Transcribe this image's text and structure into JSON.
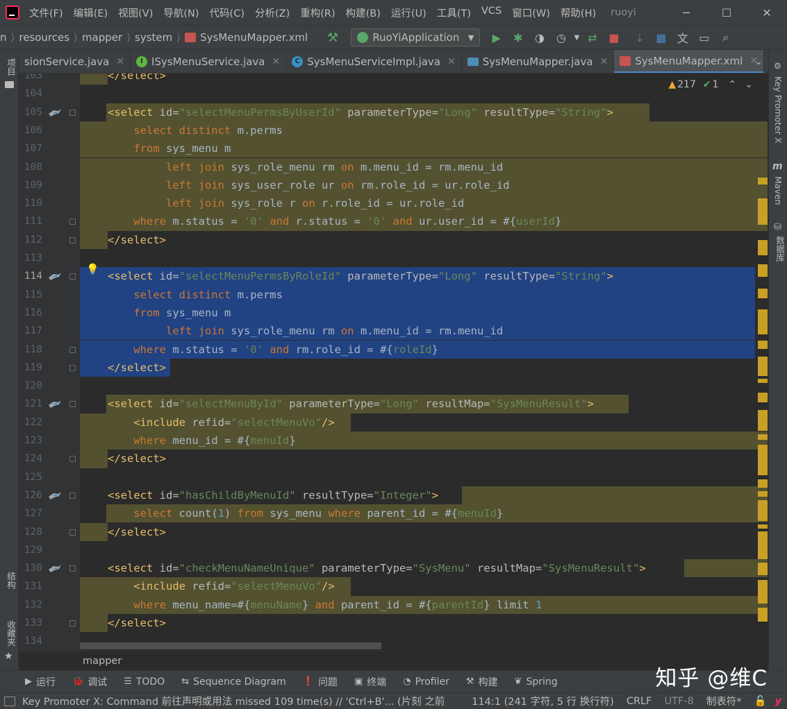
{
  "menubar": {
    "items": [
      "文件(F)",
      "编辑(E)",
      "视图(V)",
      "导航(N)",
      "代码(C)",
      "分析(Z)",
      "重构(R)",
      "构建(B)",
      "运行(U)",
      "工具(T)",
      "VCS",
      "窗口(W)",
      "帮助(H)"
    ],
    "project_name": "ruoyi"
  },
  "breadcrumb": {
    "items": [
      "n",
      "resources",
      "mapper",
      "system",
      "SysMenuMapper.xml"
    ]
  },
  "run_config": {
    "label": "RuoYiApplication"
  },
  "tabs": [
    {
      "label": "sionService.java",
      "icon": "none",
      "active": false
    },
    {
      "label": "ISysMenuService.java",
      "icon": "interface",
      "active": false
    },
    {
      "label": "SysMenuServiceImpl.java",
      "icon": "class",
      "active": false
    },
    {
      "label": "SysMenuMapper.java",
      "icon": "mapper",
      "active": false
    },
    {
      "label": "SysMenuMapper.xml",
      "icon": "xml",
      "active": true
    }
  ],
  "left_tools": {
    "project": "项目",
    "structure": "结构",
    "favorites": "收藏夹"
  },
  "right_tools": {
    "key_promoter": "Key Promoter X",
    "maven": "Maven",
    "database": "数据库"
  },
  "inspections": {
    "warnings": "217",
    "ok": "1"
  },
  "editor": {
    "lines": [
      {
        "n": "103",
        "hl": [
          [
            0,
            40
          ]
        ],
        "tokens": [
          [
            "t-tag",
            "</select>"
          ]
        ]
      },
      {
        "n": "104",
        "tokens": []
      },
      {
        "n": "105",
        "bird": true,
        "fold": true,
        "hl": [
          [
            38,
            820
          ]
        ],
        "tokens": [
          [
            "t-tag",
            "<select "
          ],
          [
            "t-attr",
            "id="
          ],
          [
            "t-val",
            "\"selectMenuPermsByUserId\""
          ],
          [
            "t-attr",
            " parameterType="
          ],
          [
            "t-val",
            "\"Long\""
          ],
          [
            "t-attr",
            " resultType="
          ],
          [
            "t-val",
            "\"String\""
          ],
          [
            "t-tag",
            ">"
          ]
        ]
      },
      {
        "n": "106",
        "hl": [
          [
            0,
            990
          ]
        ],
        "tokens": [
          [
            "t-plain",
            "    "
          ],
          [
            "t-kw",
            "select distinct "
          ],
          [
            "t-plain",
            "m.perms"
          ]
        ]
      },
      {
        "n": "107",
        "hl": [
          [
            0,
            990
          ]
        ],
        "tokens": [
          [
            "t-plain",
            "    "
          ],
          [
            "t-kw",
            "from "
          ],
          [
            "t-plain",
            "sys_menu m"
          ]
        ]
      },
      {
        "n": "108",
        "hl": [
          [
            0,
            990
          ]
        ],
        "tokens": [
          [
            "t-plain",
            "         "
          ],
          [
            "t-kw",
            "left join "
          ],
          [
            "t-plain",
            "sys_role_menu rm "
          ],
          [
            "t-kw",
            "on "
          ],
          [
            "t-plain",
            "m.menu_id = rm.menu_id"
          ]
        ]
      },
      {
        "n": "109",
        "hl": [
          [
            0,
            990
          ]
        ],
        "tokens": [
          [
            "t-plain",
            "         "
          ],
          [
            "t-kw",
            "left join "
          ],
          [
            "t-plain",
            "sys_user_role ur "
          ],
          [
            "t-kw",
            "on "
          ],
          [
            "t-plain",
            "rm.role_id = ur.role_id"
          ]
        ]
      },
      {
        "n": "110",
        "hl": [
          [
            0,
            990
          ]
        ],
        "tokens": [
          [
            "t-plain",
            "         "
          ],
          [
            "t-kw",
            "left join "
          ],
          [
            "t-plain",
            "sys_role r "
          ],
          [
            "t-kw",
            "on "
          ],
          [
            "t-plain",
            "r.role_id = ur.role_id"
          ]
        ]
      },
      {
        "n": "111",
        "fold": true,
        "hl": [
          [
            0,
            990
          ]
        ],
        "tokens": [
          [
            "t-plain",
            "    "
          ],
          [
            "t-kw",
            "where "
          ],
          [
            "t-plain",
            "m.status = "
          ],
          [
            "t-val",
            "'0' "
          ],
          [
            "t-kw",
            "and "
          ],
          [
            "t-plain",
            "r.status = "
          ],
          [
            "t-val",
            "'0' "
          ],
          [
            "t-kw",
            "and "
          ],
          [
            "t-plain",
            "ur.user_id = #{"
          ],
          [
            "t-val",
            "userId"
          ],
          [
            "t-plain",
            "}"
          ]
        ]
      },
      {
        "n": "112",
        "fold": true,
        "hl": [
          [
            0,
            40
          ]
        ],
        "tokens": [
          [
            "t-tag",
            "</select>"
          ]
        ]
      },
      {
        "n": "113",
        "tokens": []
      },
      {
        "n": "114",
        "cur": true,
        "bird": true,
        "bulb": true,
        "fold": true,
        "sel": [
          [
            0,
            972
          ]
        ],
        "tokens": [
          [
            "t-tag",
            "<select "
          ],
          [
            "t-attr",
            "id="
          ],
          [
            "t-val",
            "\"selectMenuPermsByRoleId\""
          ],
          [
            "t-attr",
            " parameterType="
          ],
          [
            "t-val",
            "\"Long\""
          ],
          [
            "t-attr",
            " resultType="
          ],
          [
            "t-val",
            "\"String\""
          ],
          [
            "t-tag",
            ">"
          ]
        ]
      },
      {
        "n": "115",
        "sel": [
          [
            0,
            972
          ]
        ],
        "tokens": [
          [
            "t-plain",
            "    "
          ],
          [
            "t-kw",
            "select distinct "
          ],
          [
            "t-plain",
            "m.perms"
          ]
        ]
      },
      {
        "n": "116",
        "sel": [
          [
            0,
            972
          ]
        ],
        "tokens": [
          [
            "t-plain",
            "    "
          ],
          [
            "t-kw",
            "from "
          ],
          [
            "t-plain",
            "sys_menu m"
          ]
        ]
      },
      {
        "n": "117",
        "sel": [
          [
            0,
            972
          ]
        ],
        "tokens": [
          [
            "t-plain",
            "         "
          ],
          [
            "t-kw",
            "left join "
          ],
          [
            "t-plain",
            "sys_role_menu rm "
          ],
          [
            "t-kw",
            "on "
          ],
          [
            "t-plain",
            "m.menu_id = rm.menu_id"
          ]
        ]
      },
      {
        "n": "118",
        "fold": true,
        "sel": [
          [
            0,
            972
          ]
        ],
        "tokens": [
          [
            "t-plain",
            "    "
          ],
          [
            "t-kw",
            "where "
          ],
          [
            "t-plain",
            "m.status = "
          ],
          [
            "t-val",
            "'0' "
          ],
          [
            "t-kw",
            "and "
          ],
          [
            "t-plain",
            "rm.role_id = #{"
          ],
          [
            "t-val",
            "roleId"
          ],
          [
            "t-plain",
            "}"
          ]
        ]
      },
      {
        "n": "119",
        "fold": true,
        "sel": [
          [
            0,
            130
          ]
        ],
        "tokens": [
          [
            "t-tag",
            "</select>"
          ]
        ]
      },
      {
        "n": "120",
        "tokens": []
      },
      {
        "n": "121",
        "bird": true,
        "fold": true,
        "hl": [
          [
            38,
            790
          ]
        ],
        "tokens": [
          [
            "t-tag",
            "<select "
          ],
          [
            "t-attr",
            "id="
          ],
          [
            "t-val",
            "\"selectMenuById\""
          ],
          [
            "t-attr",
            " parameterType="
          ],
          [
            "t-val",
            "\"Long\""
          ],
          [
            "t-attr",
            " resultMap="
          ],
          [
            "t-val",
            "\"SysMenuResult\""
          ],
          [
            "t-tag",
            ">"
          ]
        ]
      },
      {
        "n": "122",
        "hl": [
          [
            0,
            390
          ]
        ],
        "tokens": [
          [
            "t-plain",
            "    "
          ],
          [
            "t-tag",
            "<include "
          ],
          [
            "t-attr",
            "refid="
          ],
          [
            "t-val",
            "\"selectMenuVo\""
          ],
          [
            "t-tag",
            "/>"
          ]
        ]
      },
      {
        "n": "123",
        "hl": [
          [
            0,
            990
          ]
        ],
        "tokens": [
          [
            "t-plain",
            "    "
          ],
          [
            "t-kw",
            "where "
          ],
          [
            "t-plain",
            "menu_id = #{"
          ],
          [
            "t-val",
            "menuId"
          ],
          [
            "t-plain",
            "}"
          ]
        ]
      },
      {
        "n": "124",
        "fold": true,
        "hl": [
          [
            0,
            40
          ]
        ],
        "tokens": [
          [
            "t-tag",
            "</select>"
          ]
        ]
      },
      {
        "n": "125",
        "tokens": []
      },
      {
        "n": "126",
        "bird": true,
        "fold": true,
        "hl": [
          [
            550,
            990
          ]
        ],
        "tokens": [
          [
            "t-tag",
            "<select "
          ],
          [
            "t-attr",
            "id="
          ],
          [
            "t-val",
            "\"hasChildByMenuId\""
          ],
          [
            "t-attr",
            " resultType="
          ],
          [
            "t-val",
            "\"Integer\""
          ],
          [
            "t-tag",
            ">"
          ]
        ]
      },
      {
        "n": "127",
        "hl": [
          [
            38,
            990
          ]
        ],
        "tokens": [
          [
            "t-plain",
            "    "
          ],
          [
            "t-kw",
            "select "
          ],
          [
            "t-plain",
            "count("
          ],
          [
            "t-num",
            "1"
          ],
          [
            "t-plain",
            ") "
          ],
          [
            "t-kw",
            "from "
          ],
          [
            "t-plain",
            "sys_menu "
          ],
          [
            "t-kw",
            "where "
          ],
          [
            "t-plain",
            "parent_id = #{"
          ],
          [
            "t-val",
            "menuId"
          ],
          [
            "t-plain",
            "}"
          ]
        ]
      },
      {
        "n": "128",
        "fold": true,
        "hl": [
          [
            0,
            40
          ]
        ],
        "tokens": [
          [
            "t-tag",
            "</select>"
          ]
        ]
      },
      {
        "n": "129",
        "tokens": []
      },
      {
        "n": "130",
        "bird": true,
        "fold": true,
        "hl": [
          [
            870,
            990
          ]
        ],
        "tokens": [
          [
            "t-tag",
            "<select "
          ],
          [
            "t-attr",
            "id="
          ],
          [
            "t-val",
            "\"checkMenuNameUnique\""
          ],
          [
            "t-attr",
            " parameterType="
          ],
          [
            "t-val",
            "\"SysMenu\""
          ],
          [
            "t-attr",
            " resultMap="
          ],
          [
            "t-val",
            "\"SysMenuResult\""
          ],
          [
            "t-tag",
            ">"
          ]
        ]
      },
      {
        "n": "131",
        "hl": [
          [
            0,
            390
          ]
        ],
        "tokens": [
          [
            "t-plain",
            "    "
          ],
          [
            "t-tag",
            "<include "
          ],
          [
            "t-attr",
            "refid="
          ],
          [
            "t-val",
            "\"selectMenuVo\""
          ],
          [
            "t-tag",
            "/>"
          ]
        ]
      },
      {
        "n": "132",
        "hl": [
          [
            0,
            990
          ]
        ],
        "tokens": [
          [
            "t-plain",
            "    "
          ],
          [
            "t-kw",
            "where "
          ],
          [
            "t-plain",
            "menu_name=#{"
          ],
          [
            "t-val",
            "menuName"
          ],
          [
            "t-plain",
            "} "
          ],
          [
            "t-kw",
            "and "
          ],
          [
            "t-plain",
            "parent_id = #{"
          ],
          [
            "t-val",
            "parentId"
          ],
          [
            "t-plain",
            "} limit "
          ],
          [
            "t-num",
            "1"
          ]
        ]
      },
      {
        "n": "133",
        "fold": true,
        "hl": [
          [
            0,
            40
          ]
        ],
        "tokens": [
          [
            "t-tag",
            "</select>"
          ]
        ]
      },
      {
        "n": "134",
        "tokens": []
      }
    ]
  },
  "editor_breadcrumb": "mapper",
  "tool_windows": [
    {
      "icon": "▶",
      "label": "运行"
    },
    {
      "icon": "🐞",
      "label": "调试"
    },
    {
      "icon": "☰",
      "label": "TODO"
    },
    {
      "icon": "⇆",
      "label": "Sequence Diagram"
    },
    {
      "icon": "❗",
      "label": "问题"
    },
    {
      "icon": "▣",
      "label": "终端"
    },
    {
      "icon": "◔",
      "label": "Profiler"
    },
    {
      "icon": "⚒",
      "label": "构建"
    },
    {
      "icon": "❦",
      "label": "Spring"
    }
  ],
  "watermark": "知乎 @维C",
  "status": {
    "message": "Key Promoter X: Command 前往声明或用法 missed 109 time(s) // 'Ctrl+B'... (片刻 之前",
    "position": "114:1 (241 字符, 5 行 换行符)",
    "line_sep": "CRLF",
    "encoding": "UTF-8",
    "indent": "制表符*"
  },
  "colors": {
    "accent": "#4a88c7",
    "selection": "#214283",
    "highlight": "#535130",
    "keyword": "#cc7832",
    "tag": "#e8bf6a",
    "string": "#6a8759"
  }
}
